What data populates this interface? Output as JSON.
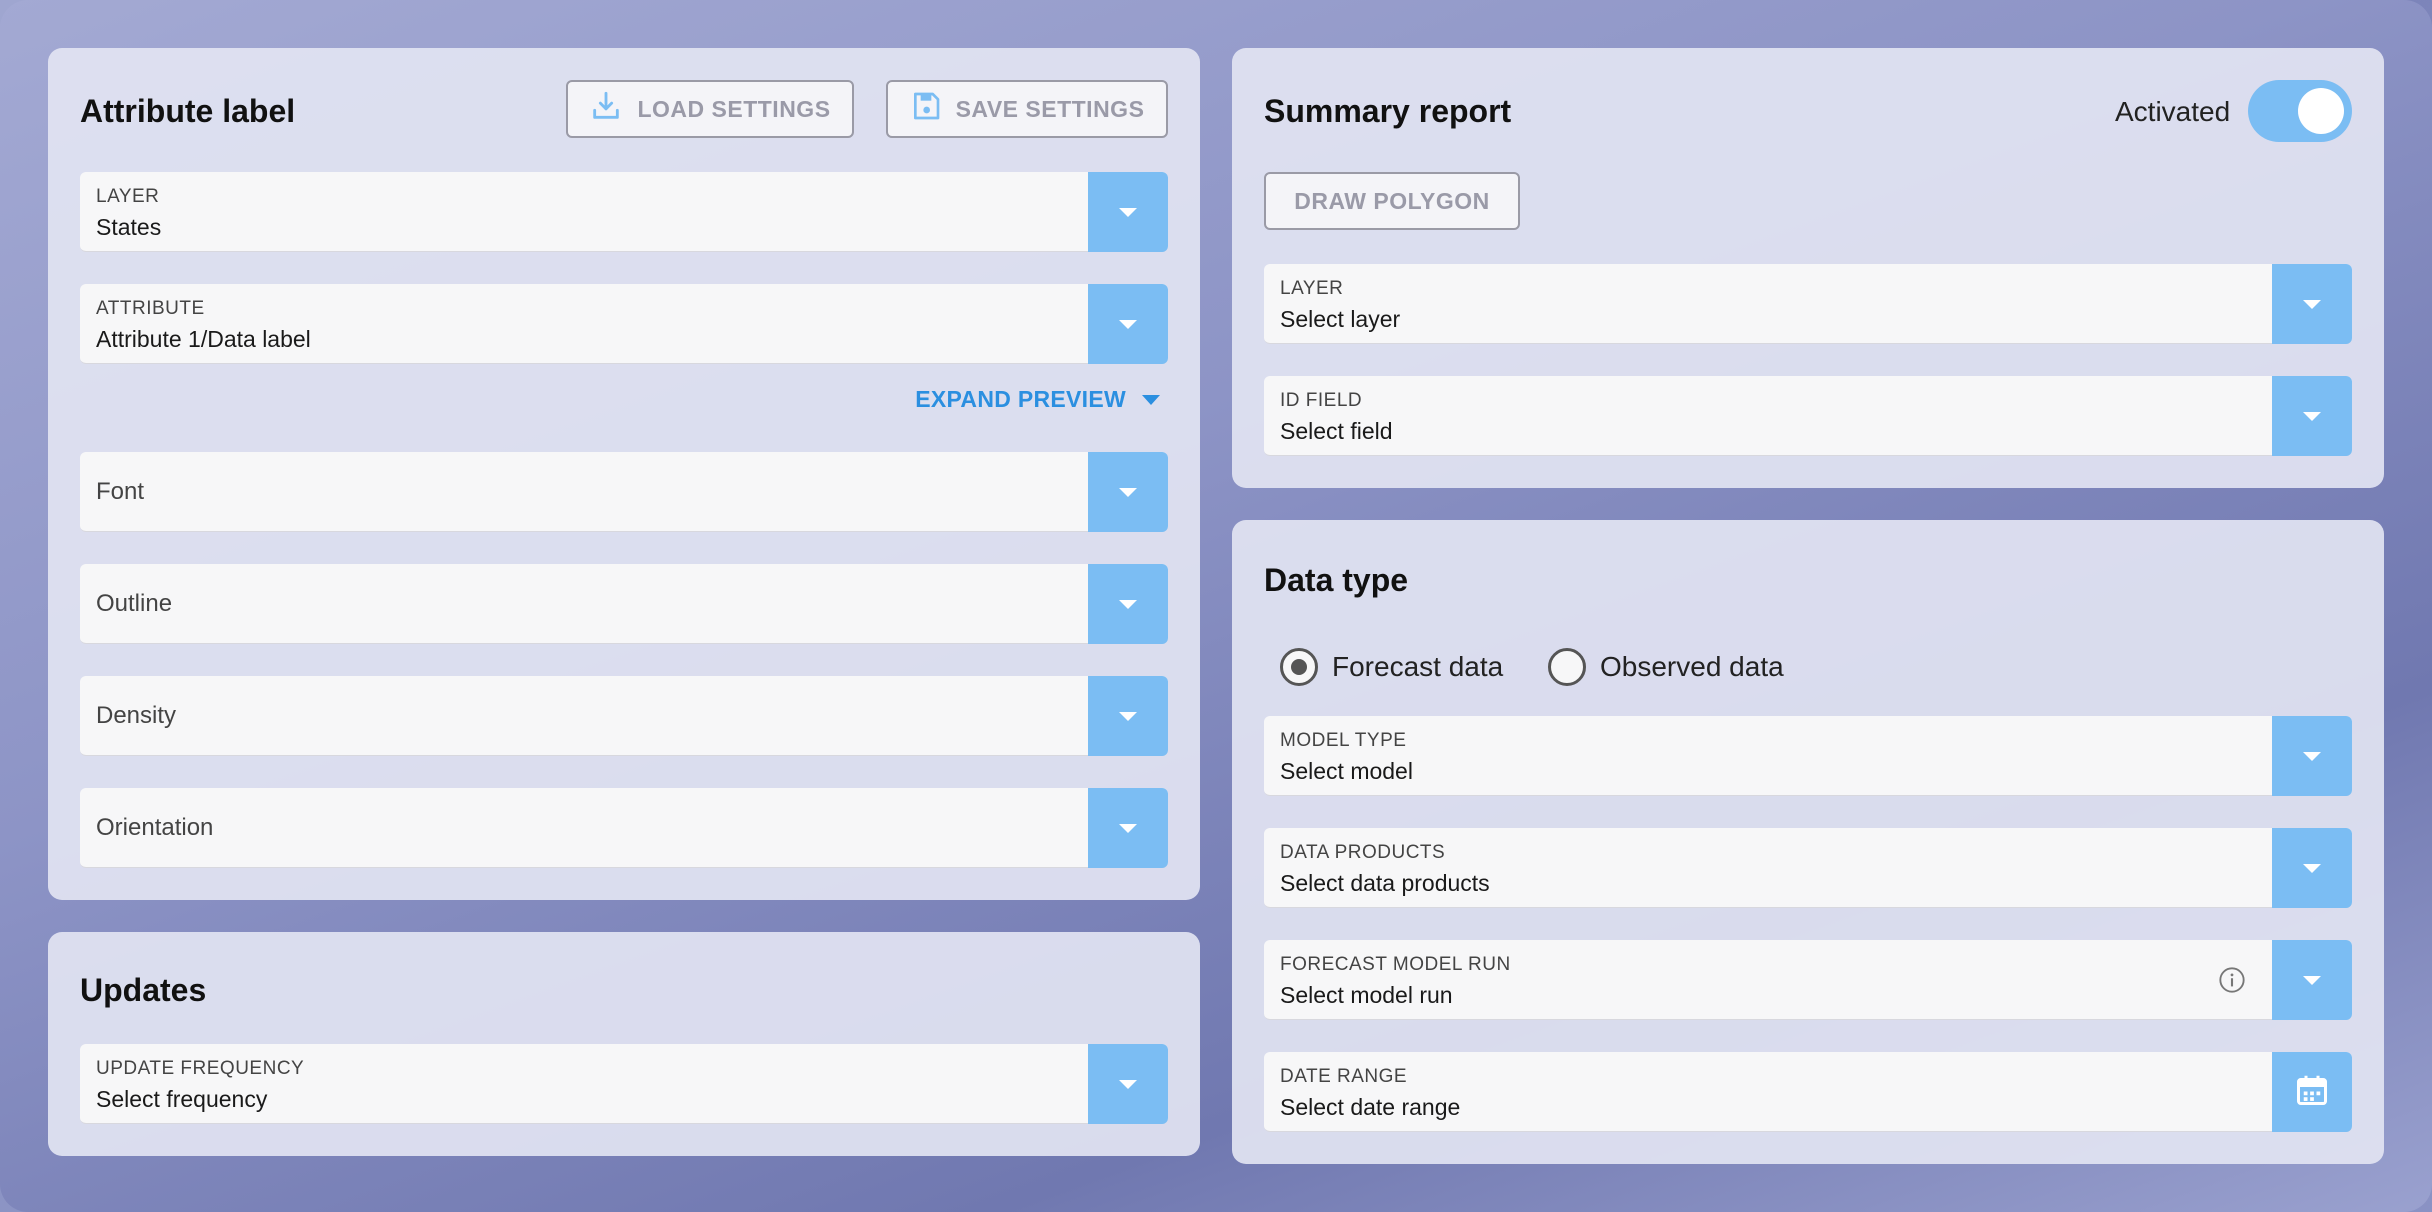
{
  "attribute_panel": {
    "title": "Attribute label",
    "load_settings": "LOAD SETTINGS",
    "save_settings": "SAVE SETTINGS",
    "layer": {
      "label": "LAYER",
      "value": "States"
    },
    "attribute": {
      "label": "ATTRIBUTE",
      "value": "Attribute 1/Data label"
    },
    "expand_preview": "EXPAND PREVIEW",
    "font": "Font",
    "outline": "Outline",
    "density": "Density",
    "orientation": "Orientation"
  },
  "updates_panel": {
    "title": "Updates",
    "update_frequency": {
      "label": "UPDATE FREQUENCY",
      "value": "Select frequency"
    }
  },
  "summary_panel": {
    "title": "Summary report",
    "toggle_label": "Activated",
    "toggle_on": true,
    "draw_polygon": "DRAW POLYGON",
    "layer": {
      "label": "LAYER",
      "value": "Select layer"
    },
    "id_field": {
      "label": "ID FIELD",
      "value": "Select field"
    }
  },
  "data_type_panel": {
    "title": "Data type",
    "radio_forecast": "Forecast data",
    "radio_observed": "Observed data",
    "selected": "Forecast data",
    "model_type": {
      "label": "MODEL TYPE",
      "value": "Select model"
    },
    "data_products": {
      "label": "DATA PRODUCTS",
      "value": "Select data products"
    },
    "forecast_model_run": {
      "label": "FORECAST MODEL RUN",
      "value": "Select model run"
    },
    "date_range": {
      "label": "DATE RANGE",
      "value": "Select date range"
    }
  },
  "colors": {
    "accent": "#7bbdf3",
    "link": "#2b8fe0",
    "toggle_track": "#7bbdf3"
  },
  "icons": [
    "download-icon",
    "save-icon",
    "caret-down-icon",
    "info-icon",
    "calendar-icon"
  ]
}
